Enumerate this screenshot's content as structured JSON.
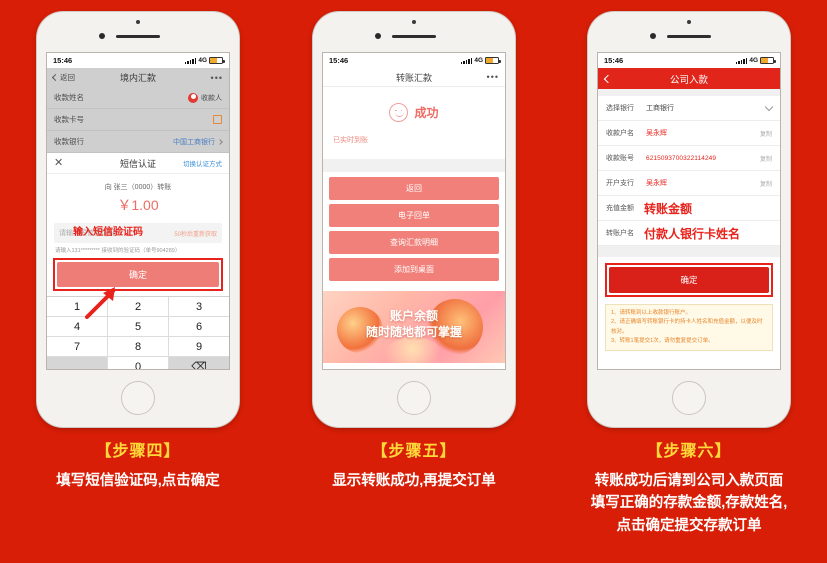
{
  "page": {
    "background_color": "#d81e06"
  },
  "columns": [
    {
      "step_label": "【步骤四】",
      "caption": [
        "填写短信验证码,点击确定"
      ],
      "phone": {
        "status_bar": {
          "time": "15:46",
          "network": "4G"
        },
        "screen": {
          "nav": {
            "back": "返回",
            "title": "境内汇款",
            "more": "•••"
          },
          "rows": [
            {
              "label": "收款姓名",
              "value": "收款人",
              "icon": "avatar-icon"
            },
            {
              "label": "收款卡号",
              "value": "",
              "icon": "scan-icon"
            },
            {
              "label": "收款银行",
              "value": "中国工商银行",
              "icon": "chevron-right-icon"
            }
          ],
          "sheet": {
            "close": "✕",
            "title": "短信认证",
            "switch_link": "切换认证方式",
            "to_line": "向 张三（0000）转账",
            "amount": "￥1.00",
            "code_placeholder": "请输入短信验证码",
            "code_annotation": "输入短信验证码",
            "resend": "50秒后重新获取",
            "hint": "请输入131********* 接收到的验证码（单号904289）",
            "confirm_label": "确定"
          },
          "keypad": {
            "keys": [
              "1",
              "2",
              "3",
              "4",
              "5",
              "6",
              "7",
              "8",
              "9",
              "",
              "0",
              "⌫"
            ]
          }
        }
      }
    },
    {
      "step_label": "【步骤五】",
      "caption": [
        "显示转账成功,再提交订单"
      ],
      "phone": {
        "status_bar": {
          "time": "15:46",
          "network": "4G"
        },
        "screen": {
          "nav": {
            "title": "转账汇款",
            "more": "•••"
          },
          "success": {
            "title": "成功",
            "subtitle": "已实时到账"
          },
          "buttons": [
            "返回",
            "电子回单",
            "查询汇款明细",
            "添加到桌面"
          ],
          "promo": {
            "line1": "账户余额",
            "line2": "随时随地都可掌握"
          }
        }
      }
    },
    {
      "step_label": "【步骤六】",
      "caption": [
        "转账成功后请到公司入款页面",
        "填写正确的存款金额,存款姓名,",
        "点击确定提交存款订单"
      ],
      "phone": {
        "status_bar": {
          "time": "15:46",
          "network": "4G"
        },
        "screen": {
          "nav": {
            "title": "公司入款",
            "back": "chevron-left-icon"
          },
          "rows": [
            {
              "label": "选择银行",
              "value": "工商银行",
              "right": "chevron-down-icon",
              "red": false
            },
            {
              "label": "收款户名",
              "value": "吴永辉",
              "right": "复制",
              "red": true
            },
            {
              "label": "收款账号",
              "value": "6215093700322114249",
              "right": "复制",
              "red": true
            },
            {
              "label": "开户支行",
              "value": "吴永辉",
              "right": "复制",
              "red": true
            },
            {
              "label": "充值金额",
              "value": "",
              "right": "",
              "red": true,
              "annotation": "转账金额"
            },
            {
              "label": "转账户名",
              "value": "",
              "right": "",
              "red": true,
              "annotation": "付款人银行卡姓名"
            }
          ],
          "confirm_label": "确定",
          "notes": [
            "1、请转账到以上收款银行账户。",
            "2、请正确填写转账银行卡的持卡人姓名和充值金额，以便及时核对。",
            "3、转账1笔提交1次，请勿重复提交订单。"
          ]
        }
      }
    }
  ]
}
